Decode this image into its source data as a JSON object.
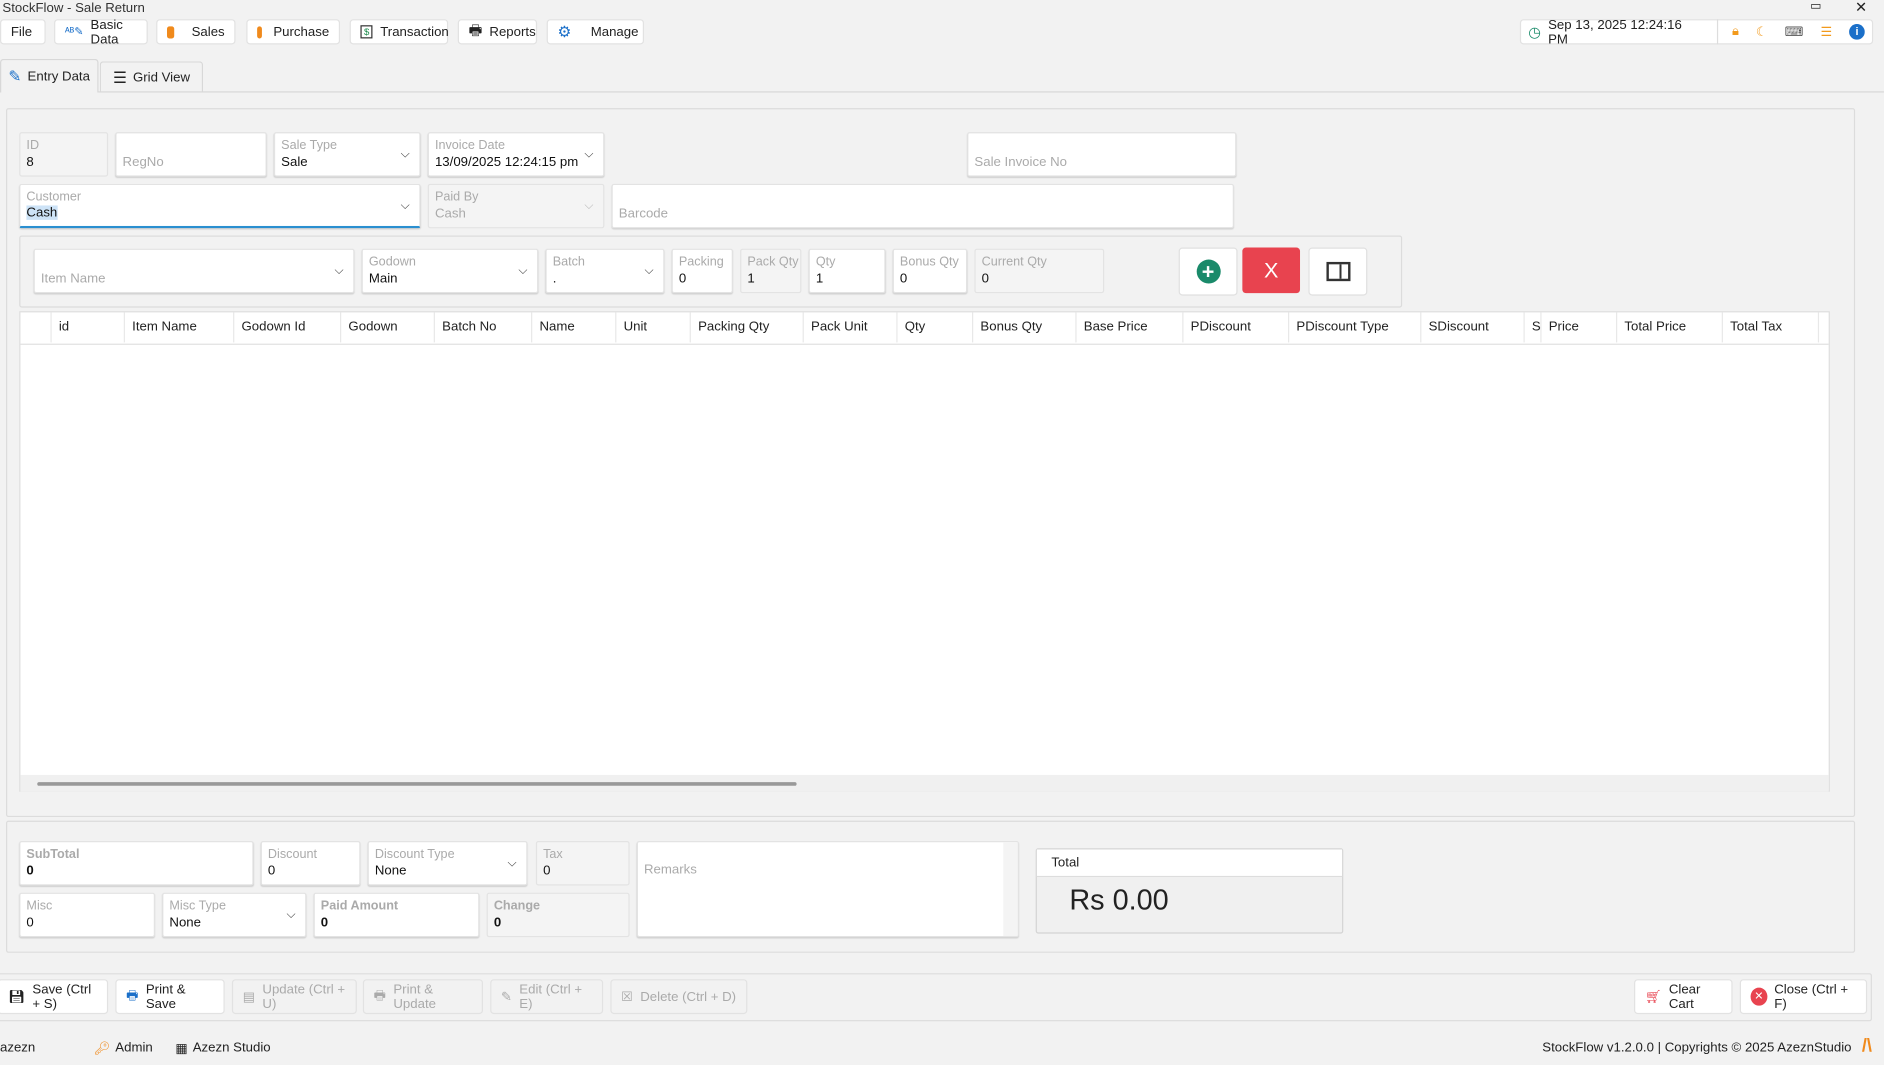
{
  "window": {
    "title": "StockFlow - Sale Return"
  },
  "menu": [
    {
      "label": "File"
    },
    {
      "label": "Basic Data"
    },
    {
      "label": "Sales"
    },
    {
      "label": "Purchase"
    },
    {
      "label": "Transaction"
    },
    {
      "label": "Reports"
    },
    {
      "label": "Manage"
    }
  ],
  "status_bar_top": {
    "datetime": "Sep 13, 2025 12:24:16 PM"
  },
  "tabs": [
    {
      "label": "Entry Data",
      "active": true
    },
    {
      "label": "Grid View",
      "active": false
    }
  ],
  "form": {
    "id": {
      "label": "ID",
      "value": "8"
    },
    "regno": {
      "placeholder": "RegNo"
    },
    "sale_type": {
      "label": "Sale Type",
      "value": "Sale"
    },
    "invoice_date": {
      "label": "Invoice Date",
      "value": "13/09/2025 12:24:15 pm"
    },
    "sale_invoice_no": {
      "placeholder": "Sale Invoice No"
    },
    "customer": {
      "label": "Customer",
      "value": "Cash"
    },
    "paid_by": {
      "label": "Paid By",
      "value": "Cash"
    },
    "barcode": {
      "placeholder": "Barcode"
    }
  },
  "item_entry": {
    "item_name": {
      "placeholder": "Item Name"
    },
    "godown": {
      "label": "Godown",
      "value": "Main"
    },
    "batch": {
      "label": "Batch",
      "value": "."
    },
    "packing": {
      "label": "Packing",
      "value": "0"
    },
    "pack_qty": {
      "label": "Pack Qty",
      "value": "1"
    },
    "qty": {
      "label": "Qty",
      "value": "1"
    },
    "bonus_qty": {
      "label": "Bonus Qty",
      "value": "0"
    },
    "current_qty": {
      "label": "Current Qty",
      "value": "0"
    },
    "remove_label": "X"
  },
  "grid": {
    "columns": [
      "id",
      "Item Name",
      "Godown Id",
      "Godown",
      "Batch No",
      "Name",
      "Unit",
      "Packing Qty",
      "Pack Unit",
      "Qty",
      "Bonus Qty",
      "Base Price",
      "PDiscount",
      "PDiscount Type",
      "SDiscount",
      "S",
      "Price",
      "Total Price",
      "Total Tax"
    ]
  },
  "totals": {
    "subtotal": {
      "label": "SubTotal",
      "value": "0"
    },
    "discount": {
      "label": "Discount",
      "value": "0"
    },
    "discount_type": {
      "label": "Discount Type",
      "value": "None"
    },
    "tax": {
      "label": "Tax",
      "value": "0"
    },
    "remarks": {
      "placeholder": "Remarks"
    },
    "misc": {
      "label": "Misc",
      "value": "0"
    },
    "misc_type": {
      "label": "Misc Type",
      "value": "None"
    },
    "paid_amount": {
      "label": "Paid Amount",
      "value": "0"
    },
    "change": {
      "label": "Change",
      "value": "0"
    },
    "total_label": "Total",
    "total_value": "Rs 0.00"
  },
  "actions": {
    "save": "Save (Ctrl + S)",
    "print_save": "Print & Save",
    "update": "Update (Ctrl + U)",
    "print_update": "Print & Update",
    "edit": "Edit (Ctrl + E)",
    "delete": "Delete (Ctrl + D)",
    "clear_cart": "Clear Cart",
    "close": "Close (Ctrl + F)"
  },
  "footer": {
    "user": "azezn",
    "role": "Admin",
    "company": "Azezn Studio",
    "copyright": "StockFlow v1.2.0.0 | Copyrights © 2025 AzeznStudio"
  }
}
